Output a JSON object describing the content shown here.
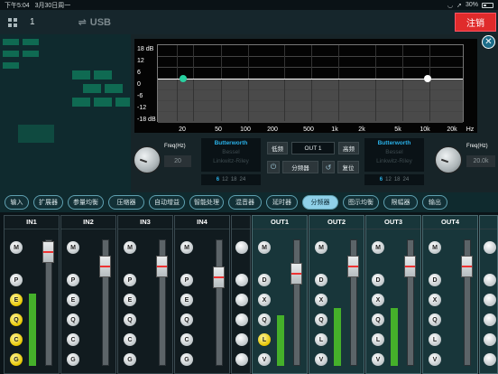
{
  "status": {
    "time": "下午5:04",
    "date": "3月30日周一",
    "battery": "30%"
  },
  "header": {
    "device_number": "1",
    "connection": "USB",
    "logout_label": "注销"
  },
  "eq": {
    "y_labels": [
      "18 dB",
      "12",
      "6",
      "0",
      "-6",
      "-12",
      "-18 dB"
    ],
    "x_labels": [
      "20",
      "50",
      "100",
      "200",
      "500",
      "1k",
      "2k",
      "5k",
      "10k",
      "20k",
      "Hz"
    ],
    "left": {
      "freq_label": "Freq(Hz)",
      "freq_value": "20",
      "filters": [
        "Butterworth",
        "Bessel",
        "Linkwitz-Riley"
      ],
      "slopes": [
        "6",
        "12",
        "18",
        "24"
      ]
    },
    "right": {
      "freq_label": "Freq(Hz)",
      "freq_value": "20.0k",
      "filters": [
        "Butterworth",
        "Bessel",
        "Linkwitz-Riley"
      ],
      "slopes": [
        "6",
        "12",
        "18",
        "24"
      ]
    },
    "low_label": "低频",
    "high_label": "高频",
    "output_name": "OUT 1",
    "crossover_label": "分频器",
    "reset_label": "复位"
  },
  "tabs": [
    "输入",
    "扩展器",
    "参量均衡",
    "压缩器",
    "自动增益",
    "智能处理",
    "混音器",
    "延时器",
    "分频器",
    "图示均衡",
    "限幅器",
    "输出"
  ],
  "active_tab": "分频器",
  "inputs": [
    {
      "name": "IN1",
      "buttons": [
        "M",
        "P",
        "E",
        "Q",
        "C",
        "G"
      ]
    },
    {
      "name": "IN2",
      "buttons": [
        "M",
        "P",
        "E",
        "Q",
        "C",
        "G"
      ]
    },
    {
      "name": "IN3",
      "buttons": [
        "M",
        "P",
        "E",
        "Q",
        "C",
        "G"
      ]
    },
    {
      "name": "IN4",
      "buttons": [
        "M",
        "P",
        "E",
        "Q",
        "C",
        "G"
      ]
    }
  ],
  "outputs": [
    {
      "name": "OUT1",
      "buttons": [
        "M",
        "D",
        "X",
        "Q",
        "L",
        "V"
      ]
    },
    {
      "name": "OUT2",
      "buttons": [
        "M",
        "D",
        "X",
        "Q",
        "L",
        "V"
      ]
    },
    {
      "name": "OUT3",
      "buttons": [
        "M",
        "D",
        "X",
        "Q",
        "L",
        "V"
      ]
    },
    {
      "name": "OUT4",
      "buttons": [
        "M",
        "D",
        "X",
        "Q",
        "L",
        "V"
      ]
    }
  ],
  "colors": {
    "accent": "#2ab1e8",
    "logout": "#e02b2b",
    "meter": "#45b02a",
    "active_button": "#e6c500"
  }
}
